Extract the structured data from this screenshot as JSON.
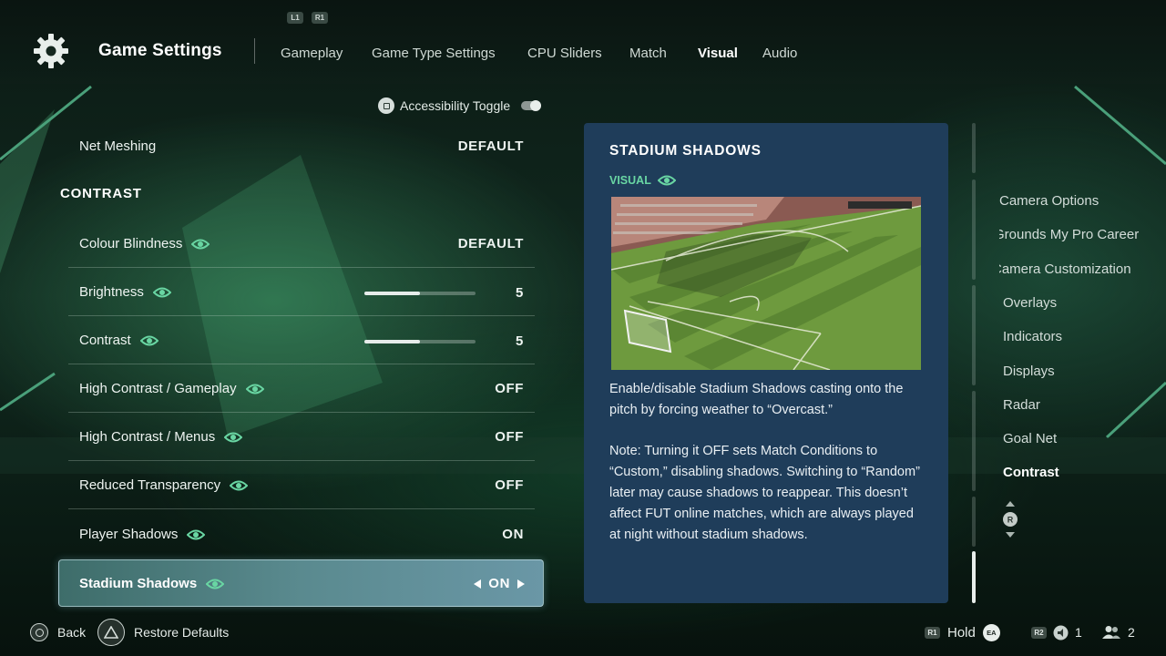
{
  "header": {
    "title": "Game Settings",
    "shoulder_left": "L1",
    "shoulder_right": "R1",
    "tabs": [
      {
        "label": "Gameplay",
        "active": false
      },
      {
        "label": "Game Type Settings",
        "active": false
      },
      {
        "label": "CPU Sliders",
        "active": false
      },
      {
        "label": "Match",
        "active": false
      },
      {
        "label": "Visual",
        "active": true
      },
      {
        "label": "Audio",
        "active": false
      }
    ]
  },
  "accessibility_toggle": {
    "label": "Accessibility Toggle",
    "on": false
  },
  "settings": {
    "net_meshing": {
      "label": "Net Meshing",
      "value": "DEFAULT"
    },
    "section_title": "CONTRAST",
    "colour_blindness": {
      "label": "Colour Blindness",
      "value": "DEFAULT"
    },
    "brightness": {
      "label": "Brightness",
      "value": "5",
      "level": 0.5
    },
    "contrast": {
      "label": "Contrast",
      "value": "5",
      "level": 0.5
    },
    "high_contrast_gameplay": {
      "label": "High Contrast / Gameplay",
      "value": "OFF"
    },
    "high_contrast_menus": {
      "label": "High Contrast / Menus",
      "value": "OFF"
    },
    "reduced_transparency": {
      "label": "Reduced Transparency",
      "value": "OFF"
    },
    "player_shadows": {
      "label": "Player Shadows",
      "value": "ON"
    },
    "stadium_shadows": {
      "label": "Stadium Shadows",
      "value": "ON",
      "selected": true
    }
  },
  "info_panel": {
    "title": "STADIUM SHADOWS",
    "tag": "VISUAL",
    "description": "Enable/disable Stadium Shadows casting onto the pitch by forcing weather to “Overcast.”",
    "note": "Note: Turning it OFF sets Match Conditions to “Custom,” disabling shadows. Switching to “Random” later may cause shadows to reappear. This doesn’t affect FUT online matches, which are always played at night without stadium shadows."
  },
  "right_nav": {
    "items": [
      {
        "label": "Camera Options",
        "active": false
      },
      {
        "label": "The Grounds My Pro Career",
        "active": false
      },
      {
        "label": "Camera Customization",
        "active": false
      },
      {
        "label": "Overlays",
        "active": false
      },
      {
        "label": "Indicators",
        "active": false
      },
      {
        "label": "Displays",
        "active": false
      },
      {
        "label": "Radar",
        "active": false
      },
      {
        "label": "Goal Net",
        "active": false
      },
      {
        "label": "Contrast",
        "active": true
      }
    ],
    "stick_label": "R"
  },
  "footer": {
    "back_label": "Back",
    "restore_label": "Restore Defaults",
    "hold_button": "R1",
    "hold_label": "Hold",
    "ea_label": "EA",
    "r2_label": "R2",
    "voice_count": "1",
    "players_count": "2"
  },
  "colors": {
    "accent_green": "#69d6a3",
    "panel_blue": "#1f3d5a",
    "selected_row": "#5a8a8f"
  }
}
